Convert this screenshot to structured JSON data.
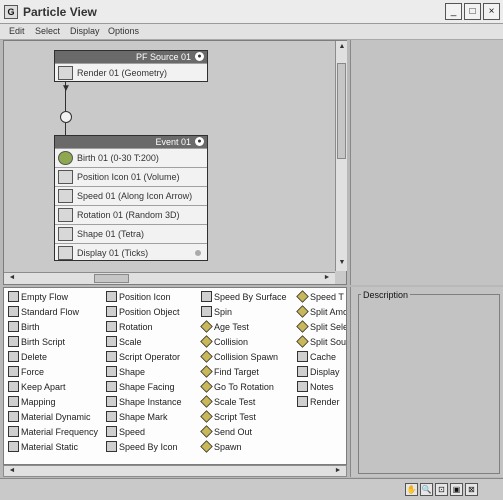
{
  "window": {
    "title": "Particle View",
    "minimize_glyph": "_",
    "maximize_glyph": "□",
    "close_glyph": "×",
    "app_icon_glyph": "G"
  },
  "menu": [
    "Edit",
    "Select",
    "Display",
    "Options"
  ],
  "graph": {
    "pf_source": {
      "header": "PF Source 01",
      "operators": [
        "Render 01 (Geometry)"
      ]
    },
    "event": {
      "header": "Event 01",
      "operators": [
        "Birth 01 (0-30 T:200)",
        "Position Icon 01 (Volume)",
        "Speed 01 (Along Icon Arrow)",
        "Rotation 01 (Random 3D)",
        "Shape 01 (Tetra)",
        "Display 01 (Ticks)"
      ]
    }
  },
  "description_label": "Description",
  "palette": {
    "columns": [
      [
        "Empty Flow",
        "Standard Flow",
        "Birth",
        "Birth Script",
        "Delete",
        "Force",
        "Keep Apart",
        "Mapping",
        "Material Dynamic",
        "Material Frequency",
        "Material Static"
      ],
      [
        "Position Icon",
        "Position Object",
        "Rotation",
        "Scale",
        "Script Operator",
        "Shape",
        "Shape Facing",
        "Shape Instance",
        "Shape Mark",
        "Speed",
        "Speed By Icon"
      ],
      [
        "Speed By Surface",
        "Spin",
        "Age Test",
        "Collision",
        "Collision Spawn",
        "Find Target",
        "Go To Rotation",
        "Scale Test",
        "Script Test",
        "Send Out",
        "Spawn"
      ],
      [
        "Speed T",
        "Split Amo",
        "Split Sele",
        "Split Sou",
        "Cache",
        "Display",
        "Notes",
        "Render"
      ]
    ]
  },
  "icons": [
    "app-icon",
    "minimize-icon",
    "maximize-icon",
    "close-icon",
    "pan-icon",
    "zoom-icon",
    "zoom-region-icon",
    "zoom-extents-icon",
    "no-zoom-icon"
  ],
  "status_glyphs": [
    "✋",
    "🔍",
    "⊡",
    "▣",
    "⊠"
  ],
  "scroll_glyphs": {
    "up": "▲",
    "down": "▼",
    "left": "◄",
    "right": "►"
  }
}
